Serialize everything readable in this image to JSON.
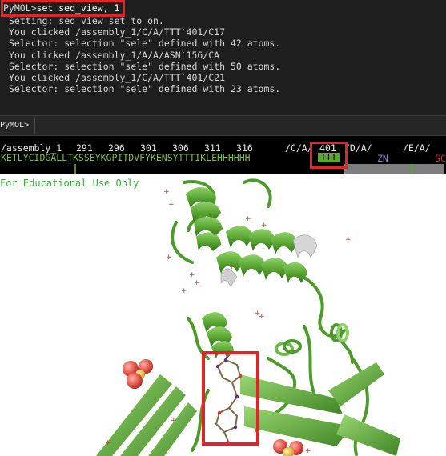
{
  "console": {
    "command_prompt": "PyMOL>",
    "command_text": "set seq_view, 1",
    "log_lines": [
      "Setting: seq_view set to on.",
      "You clicked /assembly_1/C/A/TTT`401/C17",
      "Selector: selection \"sele\" defined with 42 atoms.",
      "You clicked /assembly_1/A/A/ASN`156/CA",
      "Selector: selection \"sele\" defined with 50 atoms.",
      "You clicked /assembly_1/C/A/TTT`401/C21",
      "Selector: selection \"sele\" defined with 23 atoms."
    ]
  },
  "command_bar": {
    "prompt": "PyMOL>",
    "input_value": ""
  },
  "sequence_viewer": {
    "object_name": "/assembly_1",
    "ruler_numbers": [
      "291",
      "296",
      "301",
      "306",
      "311",
      "316"
    ],
    "chain_labels": [
      "/C/A/",
      "401",
      "/D/A/",
      "/E/A/"
    ],
    "residues": "KETLYCIDGALLTKSSEYKGPITDVFYKENSYTTTIKLEHHHHHH",
    "ligand_ttt": "TTT",
    "ligand_zn": "ZN",
    "ligand_so4": "SC"
  },
  "viewport": {
    "watermark": "For Educational Use Only"
  },
  "colors": {
    "highlight_box": "#e0242b",
    "cartoon_green": "#5aa832",
    "console_bg": "#1e1e1e",
    "sequence_green": "#7fbf4a"
  }
}
